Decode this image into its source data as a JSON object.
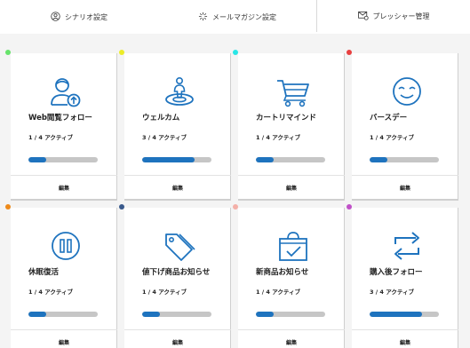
{
  "nav": {
    "scenario": "シナリオ設定",
    "magazine": "メールマガジン設定",
    "pressure": "プレッシャー管理"
  },
  "cards": [
    {
      "title": "Web閲覧フォロー",
      "status": "1 / 4 アクティブ",
      "progress": 0.25,
      "dot": "#66e36a",
      "icon": "user-upload-icon",
      "edit": "編集"
    },
    {
      "title": "ウェルカム",
      "status": "3 / 4 アクティブ",
      "progress": 0.75,
      "dot": "#ecec28",
      "icon": "location-person-icon",
      "edit": "編集"
    },
    {
      "title": "カートリマインド",
      "status": "1 / 4 アクティブ",
      "progress": 0.25,
      "dot": "#28e6e6",
      "icon": "shopping-cart-icon",
      "edit": "編集"
    },
    {
      "title": "バースデー",
      "status": "1 / 4 アクティブ",
      "progress": 0.25,
      "dot": "#e84040",
      "icon": "smile-face-icon",
      "edit": "編集"
    },
    {
      "title": "休眠復活",
      "status": "1 / 4 アクティブ",
      "progress": 0.25,
      "dot": "#ee8a1a",
      "icon": "pause-circle-icon",
      "edit": "編集"
    },
    {
      "title": "値下げ商品お知らせ",
      "status": "1 / 4 アクティブ",
      "progress": 0.25,
      "dot": "#3a5a8c",
      "icon": "price-tag-icon",
      "edit": "編集"
    },
    {
      "title": "新商品お知らせ",
      "status": "1 / 4 アクティブ",
      "progress": 0.25,
      "dot": "#f4b0a8",
      "icon": "shopping-bag-check-icon",
      "edit": "編集"
    },
    {
      "title": "購入後フォロー",
      "status": "3 / 4 アクティブ",
      "progress": 0.75,
      "dot": "#c050c8",
      "icon": "repeat-arrows-icon",
      "edit": "編集"
    }
  ]
}
